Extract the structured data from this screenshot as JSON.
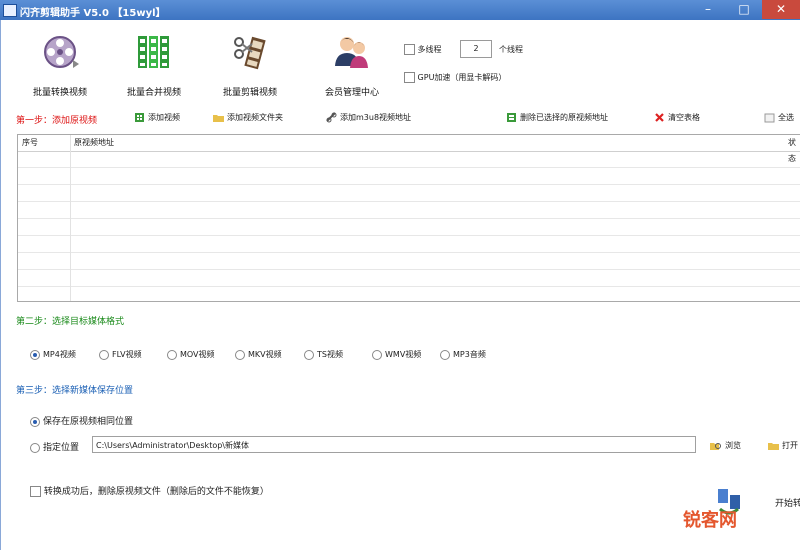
{
  "window": {
    "title": "闪齐剪辑助手 V5.0 【15wyl】"
  },
  "toolbar": {
    "items": [
      {
        "label": "批量转换视频",
        "icon": "film-reel-icon"
      },
      {
        "label": "批量合并视频",
        "icon": "film-strips-icon"
      },
      {
        "label": "批量剪辑视频",
        "icon": "scissors-film-icon"
      },
      {
        "label": "会员管理中心",
        "icon": "users-icon"
      }
    ]
  },
  "options": {
    "multi_thread_label": "多线程",
    "thread_count": "2",
    "thread_unit": "个线程",
    "gpu_label": "GPU加速（用显卡解码）"
  },
  "step1": {
    "label": "第一步：添加原视频",
    "actions": {
      "add_video": "添加视频",
      "add_folder": "添加视频文件夹",
      "add_url": "添加m3u8视频地址",
      "delete_selected": "删除已选择的原视频地址",
      "clear_table": "清空表格",
      "select_all": "全选"
    },
    "table": {
      "columns": [
        "序号",
        "原视频地址",
        "状态"
      ]
    }
  },
  "step2": {
    "label": "第二步：选择目标媒体格式",
    "formats": [
      "MP4视频",
      "FLV视频",
      "MOV视频",
      "MKV视频",
      "TS视频",
      "WMV视频",
      "MP3音频"
    ],
    "selected": "MP4视频"
  },
  "step3": {
    "label": "第三步：选择新媒体保存位置",
    "same_location_label": "保存在原视频相同位置",
    "custom_location_label": "指定位置",
    "path": "C:\\Users\\Administrator\\Desktop\\新媒体",
    "browse": "浏览",
    "open": "打开"
  },
  "footer": {
    "delete_after_label": "转换成功后，删除原视频文件（删除后的文件不能恢复）",
    "start_label": "开始转换"
  },
  "watermark": "锐客网",
  "colors": {
    "step1": "#d11111",
    "step2": "#1a8a1a",
    "step3": "#1a5fb4",
    "titlebar": "#3d74c2"
  }
}
